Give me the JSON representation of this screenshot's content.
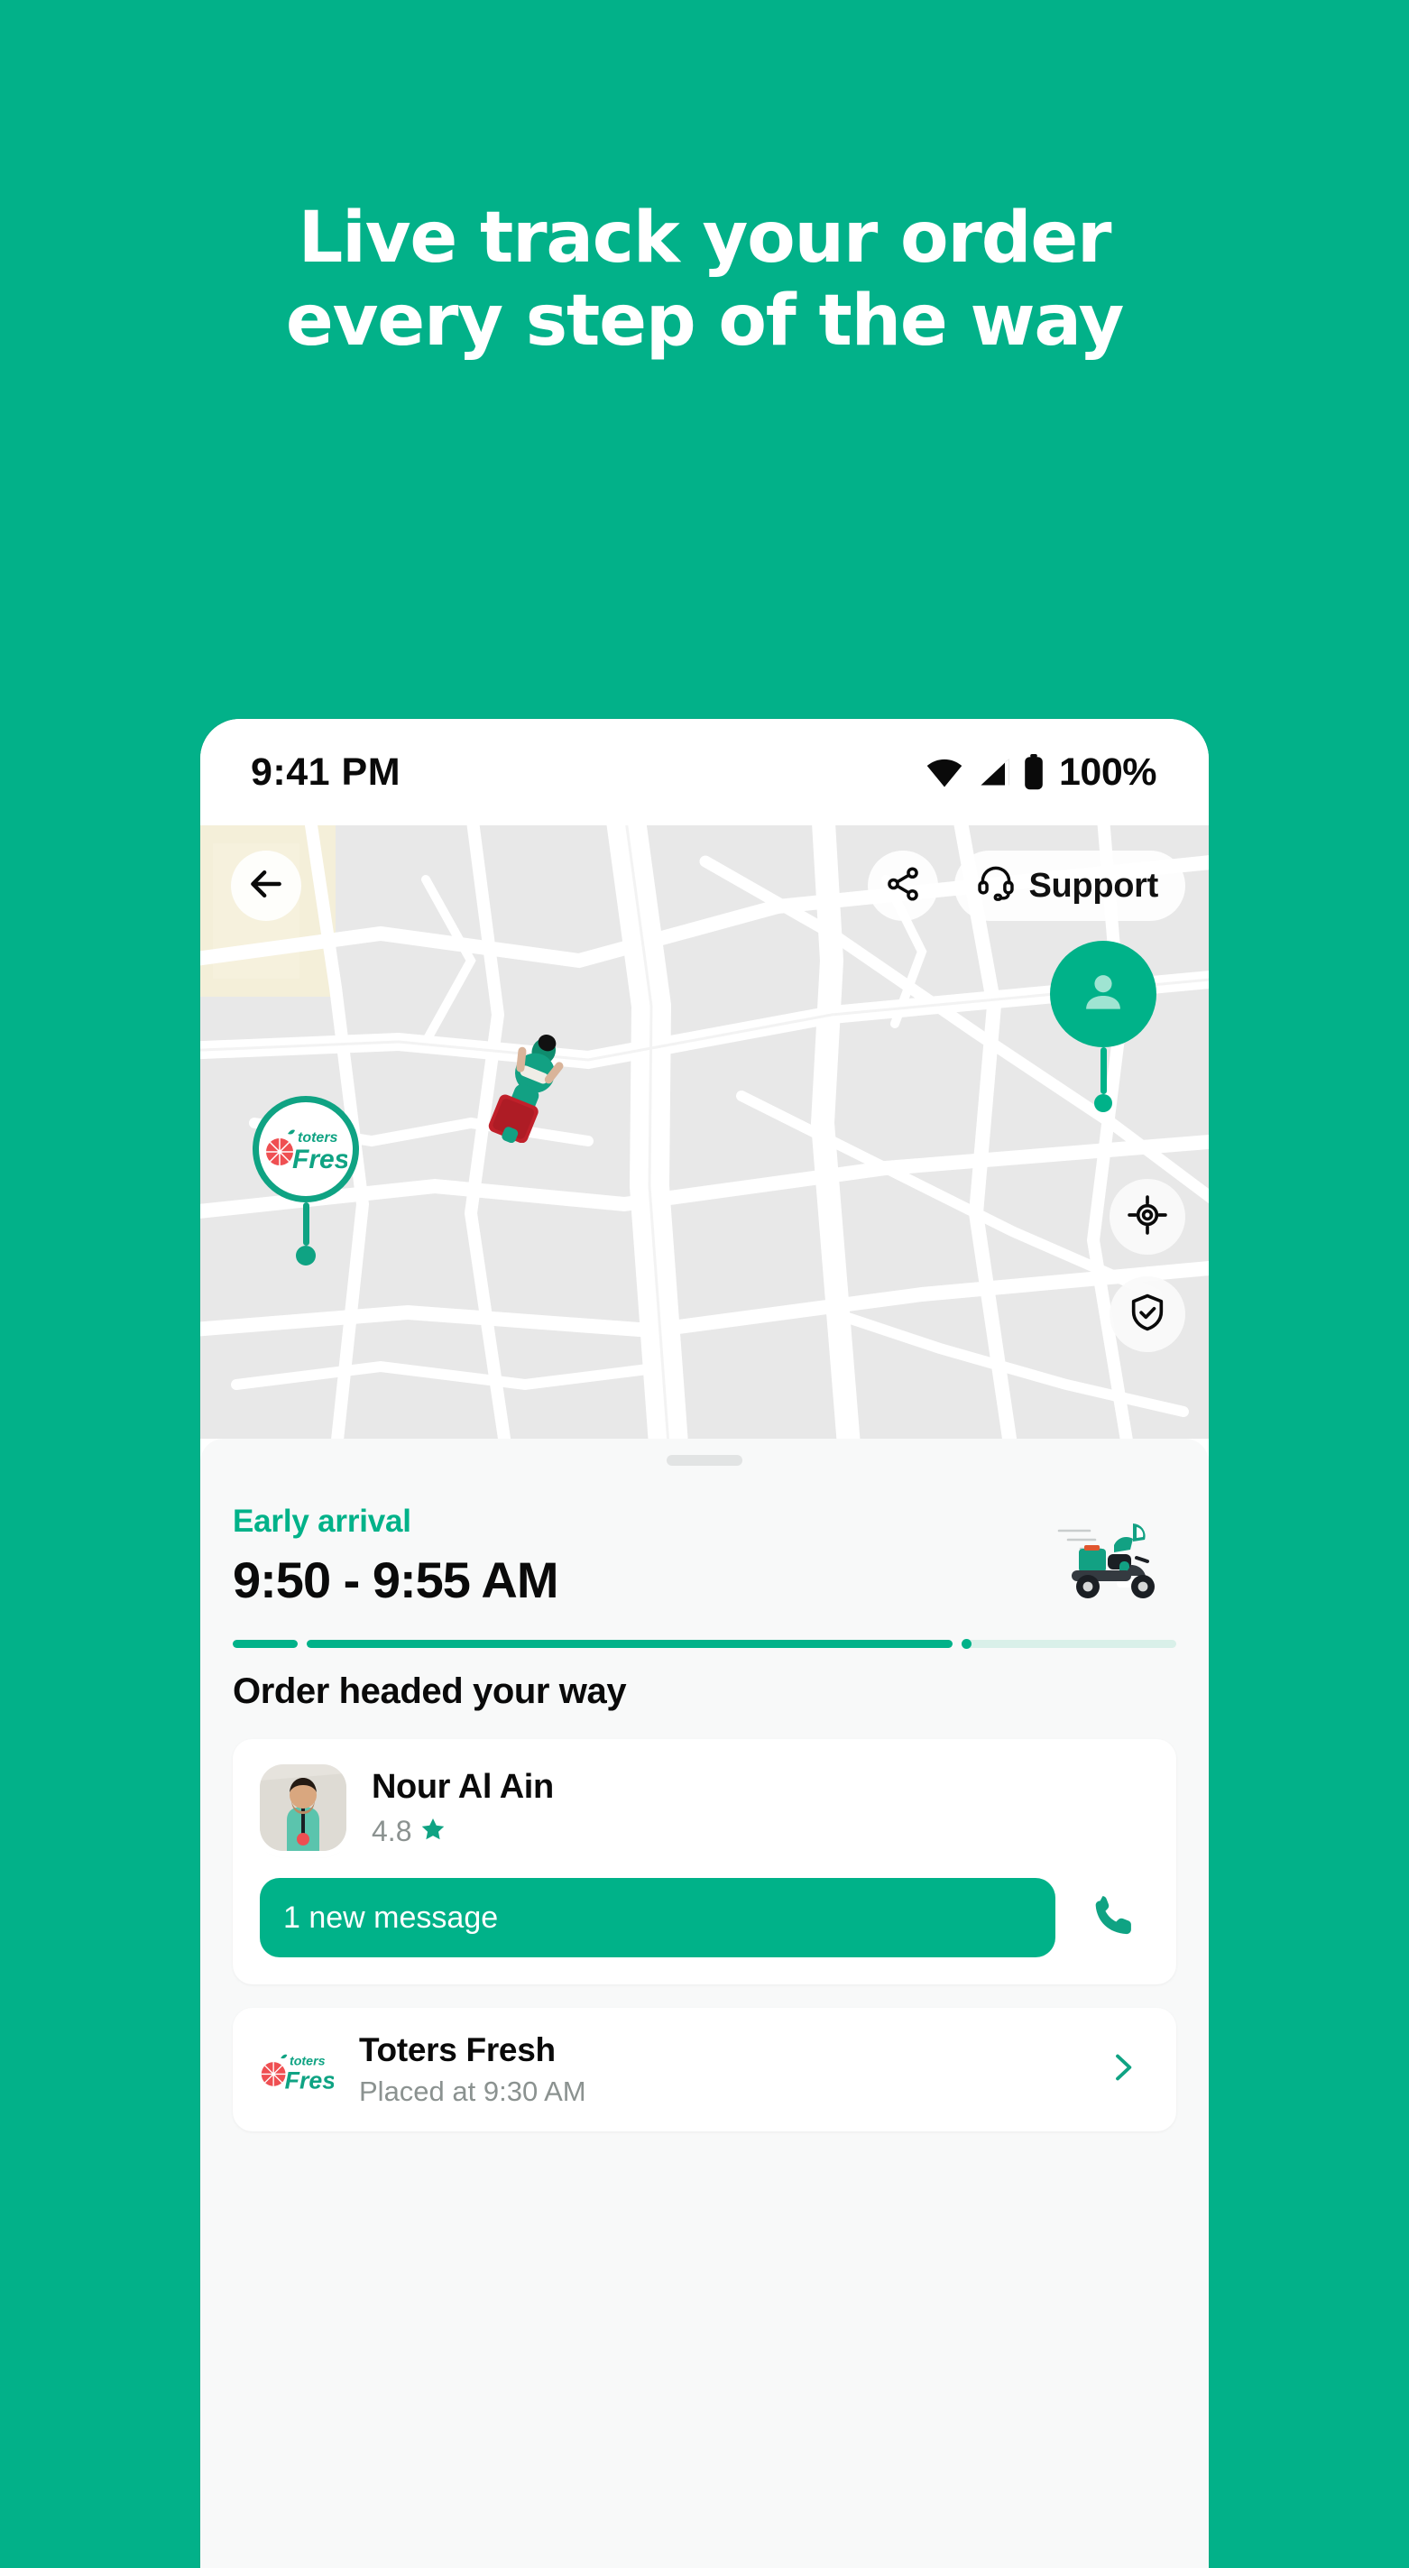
{
  "promo": {
    "headline_line1": "Live track your order",
    "headline_line2": "every step of the way",
    "background_color": "#02b189"
  },
  "status_bar": {
    "time": "9:41 PM",
    "battery_percent": "100%",
    "icons": [
      "wifi-icon",
      "cellular-signal-icon",
      "battery-icon"
    ]
  },
  "map": {
    "back_button": "back-arrow-icon",
    "share_button": "share-icon",
    "support_label": "Support",
    "support_icon": "headset-icon",
    "locate_button": "crosshair-icon",
    "safety_button": "shield-check-icon",
    "customer_marker": "person-icon",
    "store_marker_label": "toters Fresh",
    "courier_marker": "scooter-courier-top-view"
  },
  "sheet": {
    "drag_handle": "drag-handle",
    "eta_label": "Early arrival",
    "eta_time": "9:50 - 9:55 AM",
    "eta_illustration": "scooter-courier-side-view",
    "stage_text": "Order headed your way",
    "progress": {
      "segments": [
        {
          "state": "done"
        },
        {
          "state": "done"
        },
        {
          "state": "active"
        }
      ],
      "accent_color": "#00b289",
      "track_color": "#d9f0e9"
    }
  },
  "courier_card": {
    "avatar": "courier-photo",
    "name": "Nour Al Ain",
    "rating": "4.8",
    "rating_icon": "star-icon",
    "message_label": "1 new message",
    "call_icon": "phone-icon"
  },
  "store_card": {
    "logo": "toters-fresh-logo",
    "name": "Toters Fresh",
    "placed_at": "Placed at 9:30 AM",
    "chevron": "chevron-right-icon"
  }
}
